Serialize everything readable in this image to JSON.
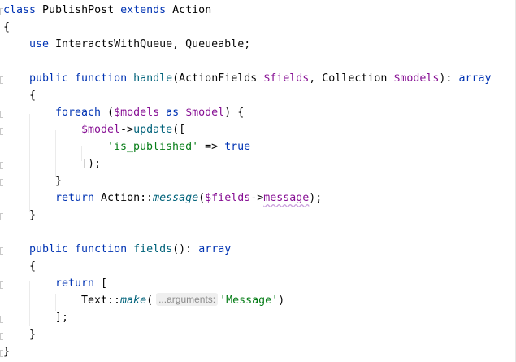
{
  "code": {
    "l1": {
      "kw_class": "class",
      "name": " PublishPost ",
      "kw_extends": "extends",
      "parent": " Action"
    },
    "l2": {
      "brace": "{"
    },
    "l3": {
      "kw_use": "use",
      "traits": " InteractsWithQueue, Queueable;"
    },
    "l5": {
      "kw_public": "public",
      "kw_function": " function ",
      "fn": "handle",
      "p1": "(ActionFields ",
      "v1": "$fields",
      "p2": ", Collection ",
      "v2": "$models",
      "p3": "): ",
      "ret": "array"
    },
    "l6": {
      "brace": "{"
    },
    "l7": {
      "kw_foreach": "foreach",
      "p1": " (",
      "v1": "$models",
      "kw_as": " as ",
      "v2": "$model",
      "p2": ") {"
    },
    "l8": {
      "v1": "$model",
      "arrow": "->",
      "fn": "update",
      "p1": "(["
    },
    "l9": {
      "str": "'is_published'",
      "op": " => ",
      "kw_true": "true"
    },
    "l10": {
      "p1": "]);"
    },
    "l11": {
      "brace": "}"
    },
    "l12": {
      "kw_return": "return",
      "cls": " Action::",
      "static_fn": "message",
      "p1": "(",
      "v1": "$fields",
      "arrow": "->",
      "prop": "message",
      "p2": ");"
    },
    "l13": {
      "brace": "}"
    },
    "l15": {
      "kw_public": "public",
      "kw_function": " function ",
      "fn": "fields",
      "p1": "(): ",
      "ret": "array"
    },
    "l16": {
      "brace": "{"
    },
    "l17": {
      "kw_return": "return",
      "p1": " ["
    },
    "l18": {
      "cls": "Text::",
      "static_fn": "make",
      "p1": "(",
      "hint": "...arguments:",
      "str": "'Message'",
      "p2": ")"
    },
    "l19": {
      "p1": "];"
    },
    "l20": {
      "brace": "}"
    },
    "l21": {
      "brace": "}"
    }
  }
}
